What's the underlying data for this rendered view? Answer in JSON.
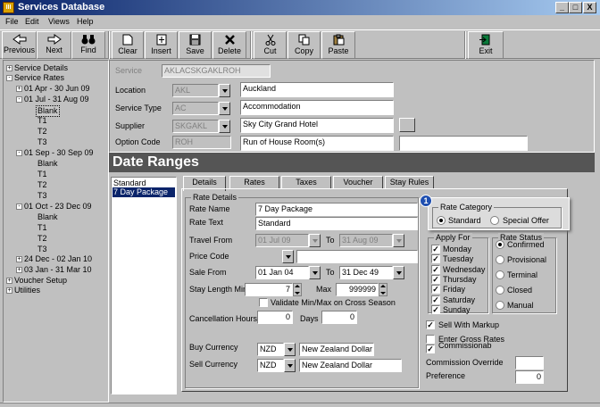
{
  "window": {
    "title": "Services Database",
    "min": "_",
    "max": "□",
    "close": "X"
  },
  "menu": [
    "File",
    "Edit",
    "Views",
    "Help"
  ],
  "toolbar": [
    {
      "name": "previous-button",
      "label": "Previous",
      "icon": "previous-icon"
    },
    {
      "name": "next-button",
      "label": "Next",
      "icon": "next-icon"
    },
    {
      "name": "find-button",
      "label": "Find",
      "icon": "binoculars-icon"
    },
    {
      "name": "clear-button",
      "label": "Clear",
      "icon": "clear-icon"
    },
    {
      "name": "insert-button",
      "label": "Insert",
      "icon": "insert-icon"
    },
    {
      "name": "save-button",
      "label": "Save",
      "icon": "save-icon"
    },
    {
      "name": "delete-button",
      "label": "Delete",
      "icon": "delete-icon"
    },
    {
      "name": "cut-button",
      "label": "Cut",
      "icon": "scissors-icon"
    },
    {
      "name": "copy-button",
      "label": "Copy",
      "icon": "copy-icon"
    },
    {
      "name": "paste-button",
      "label": "Paste",
      "icon": "paste-icon"
    },
    {
      "name": "exit-button",
      "label": "Exit",
      "icon": "exit-icon"
    }
  ],
  "tree": [
    {
      "label": "Service Details",
      "pm": "+"
    },
    {
      "label": "Service Rates",
      "pm": "-"
    },
    {
      "label": "01 Apr - 30 Jun 09",
      "pm": "+"
    },
    {
      "label": "01 Jul - 31 Aug 09",
      "pm": "-"
    },
    {
      "label": "Blank",
      "pm": ""
    },
    {
      "label": "T1",
      "pm": ""
    },
    {
      "label": "T2",
      "pm": ""
    },
    {
      "label": "T3",
      "pm": ""
    },
    {
      "label": "01 Sep - 30 Sep 09",
      "pm": "-"
    },
    {
      "label": "Blank",
      "pm": ""
    },
    {
      "label": "T1",
      "pm": ""
    },
    {
      "label": "T2",
      "pm": ""
    },
    {
      "label": "T3",
      "pm": ""
    },
    {
      "label": "01 Oct - 23 Dec 09",
      "pm": "-"
    },
    {
      "label": "Blank",
      "pm": ""
    },
    {
      "label": "T1",
      "pm": ""
    },
    {
      "label": "T2",
      "pm": ""
    },
    {
      "label": "T3",
      "pm": ""
    },
    {
      "label": "24 Dec - 02 Jan 10",
      "pm": "+"
    },
    {
      "label": "03 Jan - 31 Mar 10",
      "pm": "+"
    },
    {
      "label": "Voucher Setup",
      "pm": "+"
    },
    {
      "label": "Utilities",
      "pm": "+"
    }
  ],
  "service": {
    "service_label": "Service",
    "service_value": "AKLACSKGAKLROH",
    "location_label": "Location",
    "location_code": "AKL",
    "location_name": "Auckland",
    "type_label": "Service Type",
    "type_code": "AC",
    "type_name": "Accommodation",
    "supplier_label": "Supplier",
    "supplier_code": "SKGAKL",
    "supplier_name": "Sky City Grand Hotel",
    "option_label": "Option Code",
    "option_code": "ROH",
    "option_name": "Run of House Room(s)"
  },
  "date_ranges": {
    "heading": "Date Ranges",
    "list": [
      "Standard",
      "7 Day Package"
    ]
  },
  "tabs": [
    "Details",
    "Rates",
    "Taxes",
    "Voucher",
    "Stay Rules"
  ],
  "details": {
    "group_title": "Rate Details",
    "rate_name_label": "Rate Name",
    "rate_name": "7 Day Package",
    "rate_text_label": "Rate Text",
    "rate_text": "Standard",
    "travel_from_label": "Travel From",
    "travel_from": "01 Jul 09",
    "to_label": "To",
    "travel_to": "31 Aug 09",
    "price_code_label": "Price Code",
    "price_code": "",
    "sale_from_label": "Sale From",
    "sale_from": "01 Jan 04",
    "sale_to": "31 Dec 49",
    "stay_min_label": "Stay Length Min",
    "stay_min": "7",
    "max_label": "Max",
    "stay_max": "999999",
    "validate_label": "Validate Min/Max on Cross Season",
    "cancel_label": "Cancellation Hours",
    "cancel_hours": "0",
    "days_label": "Days",
    "days": "0",
    "buy_currency_label": "Buy Currency",
    "buy_code": "NZD",
    "buy_name": "New Zealand Dollar",
    "sell_currency_label": "Sell Currency",
    "sell_code": "NZD",
    "sell_name": "New Zealand Dollar"
  },
  "rate_category": {
    "title": "Rate Category",
    "badge": "1",
    "standard": "Standard",
    "special": "Special Offer"
  },
  "apply_for": {
    "title": "Apply For",
    "days": [
      "Monday",
      "Tuesday",
      "Wednesday",
      "Thursday",
      "Friday",
      "Saturday",
      "Sunday"
    ]
  },
  "rate_status": {
    "title": "Rate Status",
    "options": [
      "Confirmed",
      "Provisional",
      "Terminal",
      "Closed",
      "Manual"
    ]
  },
  "bottom": {
    "sell_markup": "Sell With Markup",
    "gross_rates": "Enter Gross Rates",
    "commissionable": "Commissionable",
    "commission_override_label": "Commission Override",
    "commission_override": "",
    "preference_label": "Preference",
    "preference": "0"
  }
}
